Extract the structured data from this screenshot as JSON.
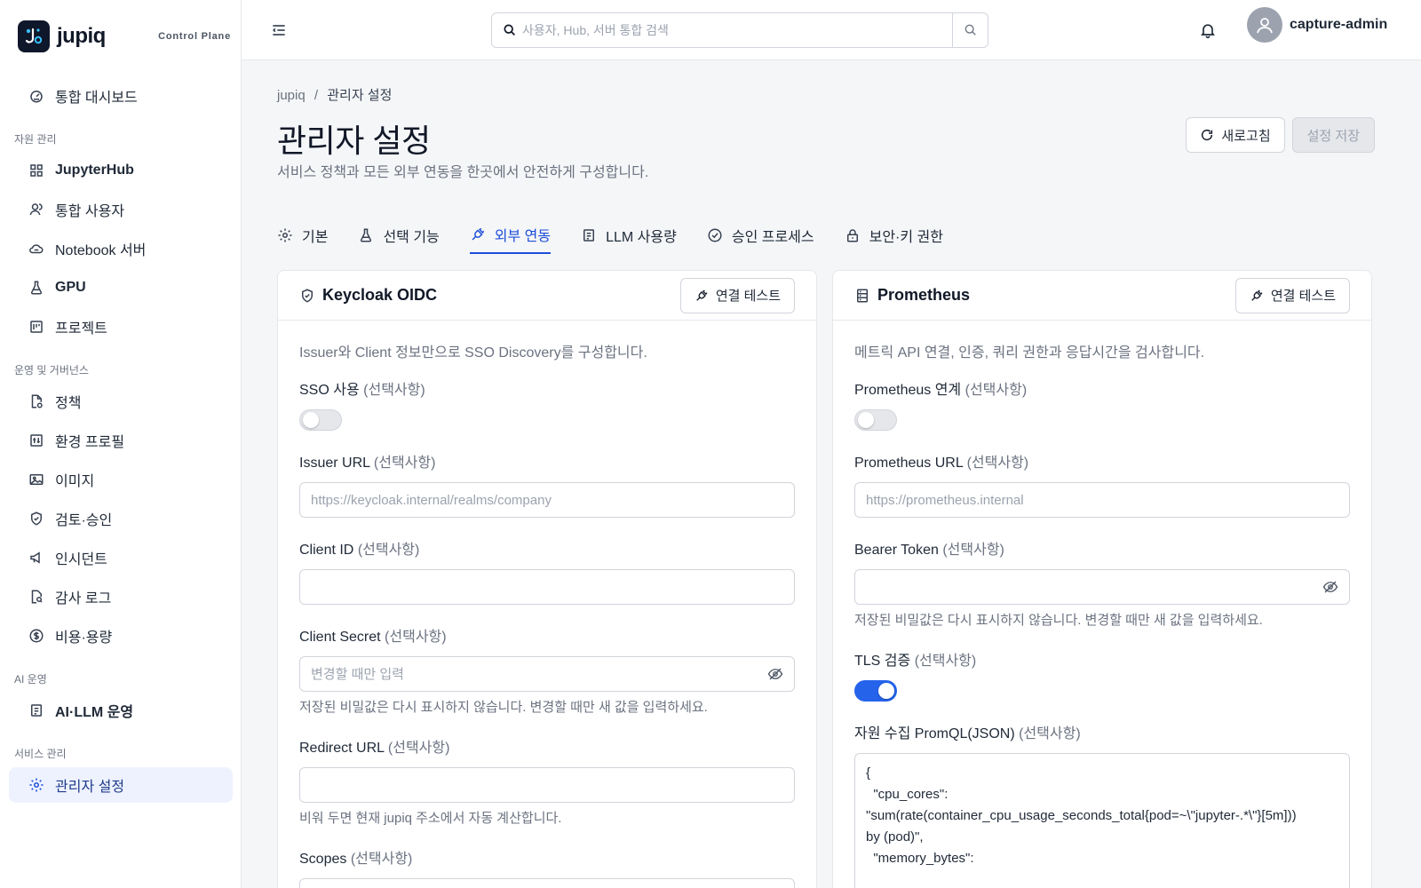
{
  "brand": {
    "name": "jupiq",
    "tagline": "Control Plane"
  },
  "sidebar": {
    "top_item": {
      "label": "통합 대시보드",
      "icon": "gauge-icon"
    },
    "sections": [
      {
        "title": "자원 관리",
        "items": [
          {
            "label": "JupyterHub",
            "icon": "grid-icon"
          },
          {
            "label": "통합 사용자",
            "icon": "users-icon"
          },
          {
            "label": "Notebook 서버",
            "icon": "cloud-icon"
          },
          {
            "label": "GPU",
            "icon": "flask-icon"
          },
          {
            "label": "프로젝트",
            "icon": "kanban-icon"
          }
        ]
      },
      {
        "title": "운영 및 거버넌스",
        "items": [
          {
            "label": "정책",
            "icon": "file-check-icon"
          },
          {
            "label": "환경 프로필",
            "icon": "sliders-icon"
          },
          {
            "label": "이미지",
            "icon": "image-icon"
          },
          {
            "label": "검토·승인",
            "icon": "shield-check-icon"
          },
          {
            "label": "인시던트",
            "icon": "megaphone-icon"
          },
          {
            "label": "감사 로그",
            "icon": "file-search-icon"
          },
          {
            "label": "비용·용량",
            "icon": "dollar-icon"
          }
        ]
      },
      {
        "title": "AI 운영",
        "items": [
          {
            "label": "AI·LLM 운영",
            "icon": "bot-icon"
          }
        ]
      },
      {
        "title": "서비스 관리",
        "items": [
          {
            "label": "관리자 설정",
            "icon": "gear-icon",
            "active": true
          }
        ]
      }
    ]
  },
  "topbar": {
    "search_placeholder": "사용자, Hub, 서버 통합 검색",
    "user_name": "capture-admin"
  },
  "page": {
    "breadcrumb_root": "jupiq",
    "breadcrumb_sep": "/",
    "breadcrumb_current": "관리자 설정",
    "title": "관리자 설정",
    "subtitle": "서비스 정책과 모든 외부 연동을 한곳에서 안전하게 구성합니다.",
    "refresh_label": "새로고침",
    "save_label": "설정 저장"
  },
  "tabs": [
    {
      "label": "기본",
      "icon": "gear-icon"
    },
    {
      "label": "선택 기능",
      "icon": "flask-icon"
    },
    {
      "label": "외부 연동",
      "icon": "plug-icon",
      "active": true
    },
    {
      "label": "LLM 사용량",
      "icon": "bot-icon"
    },
    {
      "label": "승인 프로세스",
      "icon": "check-circle-icon"
    },
    {
      "label": "보안·키 권한",
      "icon": "lock-icon"
    }
  ],
  "optional_text": "(선택사항)",
  "keycloak": {
    "title": "Keycloak OIDC",
    "test_label": "연결 테스트",
    "description": "Issuer와 Client 정보만으로 SSO Discovery를 구성합니다.",
    "sso_label": "SSO 사용",
    "sso_enabled": false,
    "issuer_label": "Issuer URL",
    "issuer_placeholder": "https://keycloak.internal/realms/company",
    "client_id_label": "Client ID",
    "client_id_value": "",
    "client_secret_label": "Client Secret",
    "client_secret_placeholder": "변경할 때만 입력",
    "client_secret_help": "저장된 비밀값은 다시 표시하지 않습니다. 변경할 때만 새 값을 입력하세요.",
    "redirect_label": "Redirect URL",
    "redirect_value": "",
    "redirect_help": "비워 두면 현재 jupiq 주소에서 자동 계산합니다.",
    "scopes_label": "Scopes"
  },
  "prometheus": {
    "title": "Prometheus",
    "test_label": "연결 테스트",
    "description": "메트릭 API 연결, 인증, 쿼리 권한과 응답시간을 검사합니다.",
    "link_label": "Prometheus 연계",
    "link_enabled": false,
    "url_label": "Prometheus URL",
    "url_placeholder": "https://prometheus.internal",
    "token_label": "Bearer Token",
    "token_help": "저장된 비밀값은 다시 표시하지 않습니다. 변경할 때만 새 값을 입력하세요.",
    "tls_label": "TLS 검증",
    "tls_enabled": true,
    "promql_label": "자원 수집 PromQL(JSON)",
    "promql_value": "{\n  \"cpu_cores\": \n\"sum(rate(container_cpu_usage_seconds_total{pod=~\\\"jupyter-.*\\\"}[5m])) \nby (pod)\",\n  \"memory_bytes\": "
  },
  "colors": {
    "accent": "#1d4ed8",
    "toggle_on": "#2563eb",
    "active_nav_bg": "#eef2ff"
  }
}
